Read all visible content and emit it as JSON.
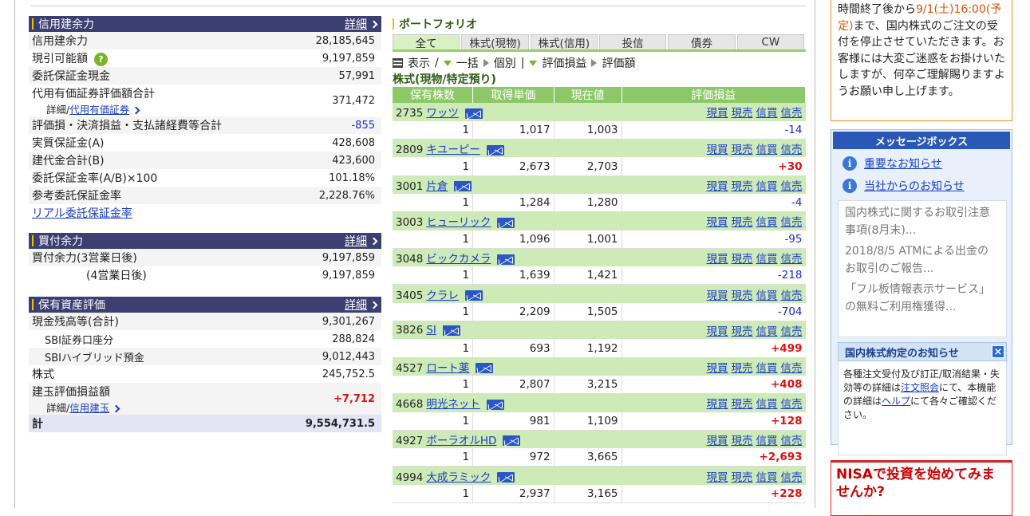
{
  "credit_section": {
    "title": "信用建余力",
    "detail": "詳細",
    "rows": [
      {
        "label": "信用建余力",
        "value": "28,185,645"
      },
      {
        "label": "現引可能額",
        "value": "9,197,859"
      },
      {
        "label": "委託保証金現金",
        "value": "57,991"
      },
      {
        "label": "代用有価証券評価額合計",
        "sub_label": "詳細/",
        "sub_link": "代用有価証券",
        "value": "371,472"
      },
      {
        "label": "評価損・決済損益・支払諸経費等合計",
        "value": "-855"
      },
      {
        "label": "実質保証金(A)",
        "value": "428,608"
      },
      {
        "label": "建代金合計(B)",
        "value": "423,600"
      },
      {
        "label": "委託保証金率(A/B)×100",
        "value": "101.18%"
      },
      {
        "label": "参考委託保証金率",
        "value": "2,228.76%"
      }
    ],
    "link": "リアル委託保証金率"
  },
  "buy_section": {
    "title": "買付余力",
    "detail": "詳細",
    "rows": [
      {
        "label": "買付余力(3営業日後)",
        "value": "9,197,859"
      },
      {
        "label": "(4営業日後)",
        "value": "9,197,859"
      }
    ]
  },
  "asset_section": {
    "title": "保有資産評価",
    "detail": "詳細",
    "rows": [
      {
        "label": "現金残高等(合計)",
        "value": "9,301,267"
      },
      {
        "label": "SBI証券口座分",
        "value": "288,824"
      },
      {
        "label": "SBIハイブリッド預金",
        "value": "9,012,443"
      },
      {
        "label": "株式",
        "value": "245,752.5"
      },
      {
        "label": "建玉評価損益額",
        "sub_label": "詳細/",
        "sub_link": "信用建玉",
        "value": "+7,712"
      },
      {
        "label": "計",
        "value": "9,554,731.5"
      }
    ]
  },
  "portfolio": {
    "title": "ポートフォリオ",
    "tabs": [
      "全て",
      "株式(現物)",
      "株式(信用)",
      "投信",
      "債券",
      "CW"
    ],
    "view": {
      "display": "表示",
      "sep": "/",
      "ikkatsu": "一括",
      "kobetsu": "個別",
      "pipe": "|",
      "hyoka_soneki": "評価損益",
      "hyoka_gaku": "評価額"
    },
    "subtitle": "株式(現物/特定預り)",
    "columns": [
      "保有株数",
      "取得単価",
      "現在値",
      "評価損益"
    ],
    "actions": [
      "現買",
      "現売",
      "信買",
      "信売"
    ],
    "rows": [
      {
        "code": "2735",
        "name": "ワッツ",
        "qty": "1",
        "cost": "1,017",
        "price": "1,003",
        "pl": "-14",
        "sign": "neg"
      },
      {
        "code": "2809",
        "name": "キユーピー",
        "qty": "1",
        "cost": "2,673",
        "price": "2,703",
        "pl": "+30",
        "sign": "pos"
      },
      {
        "code": "3001",
        "name": "片倉",
        "qty": "1",
        "cost": "1,284",
        "price": "1,280",
        "pl": "-4",
        "sign": "neg"
      },
      {
        "code": "3003",
        "name": "ヒューリック",
        "qty": "1",
        "cost": "1,096",
        "price": "1,001",
        "pl": "-95",
        "sign": "neg"
      },
      {
        "code": "3048",
        "name": "ビックカメラ",
        "qty": "1",
        "cost": "1,639",
        "price": "1,421",
        "pl": "-218",
        "sign": "neg"
      },
      {
        "code": "3405",
        "name": "クラレ",
        "qty": "1",
        "cost": "2,209",
        "price": "1,505",
        "pl": "-704",
        "sign": "neg"
      },
      {
        "code": "3826",
        "name": "SI",
        "qty": "1",
        "cost": "693",
        "price": "1,192",
        "pl": "+499",
        "sign": "pos"
      },
      {
        "code": "4527",
        "name": "ロート薬",
        "qty": "1",
        "cost": "2,807",
        "price": "3,215",
        "pl": "+408",
        "sign": "pos"
      },
      {
        "code": "4668",
        "name": "明光ネット",
        "qty": "1",
        "cost": "981",
        "price": "1,109",
        "pl": "+128",
        "sign": "pos"
      },
      {
        "code": "4927",
        "name": "ポーラオルHD",
        "qty": "1",
        "cost": "972",
        "price": "3,665",
        "pl": "+2,693",
        "sign": "pos"
      },
      {
        "code": "4994",
        "name": "大成ラミック",
        "qty": "1",
        "cost": "2,937",
        "price": "3,165",
        "pl": "+228",
        "sign": "pos"
      }
    ]
  },
  "notice": {
    "line1_pre": "時間終了後から",
    "line1_hl": "9/1(土)16:00(予定)",
    "rest": "まで、国内株式のご注文の受付を停止させていただきます。お客様には大変ご迷惑をお掛けいたしますが、何卒ご理解賜りますようお願い申し上げます。"
  },
  "message_box": {
    "title": "メッセージボックス",
    "links": [
      "重要なお知らせ",
      "当社からのお知らせ"
    ],
    "news": [
      "国内株式に関するお取引注意事項(8月末)...",
      "2018/8/5 ATMによる出金のお取引のご報告...",
      "「フル板情報表示サービス」の無料ご利用権獲得..."
    ],
    "kyt_title": "国内株式約定のお知らせ",
    "kyt_text_pre": "各種注文受付及び訂正/取消結果・失効等の詳細は",
    "kyt_link1": "注文照会",
    "kyt_text_mid": "にて、本機能の詳細は",
    "kyt_link2": "ヘルプ",
    "kyt_text_post": "にて各々ご確認ください。"
  },
  "nisa": {
    "text": "NISAで投資を始めてみませんか?"
  },
  "colors": {
    "header_navy": "#3b3f72",
    "portfolio_green": "#8dc868",
    "row_green": "#cdeab7",
    "loss_blue": "#1a2ad4",
    "gain_red": "#e01010"
  }
}
